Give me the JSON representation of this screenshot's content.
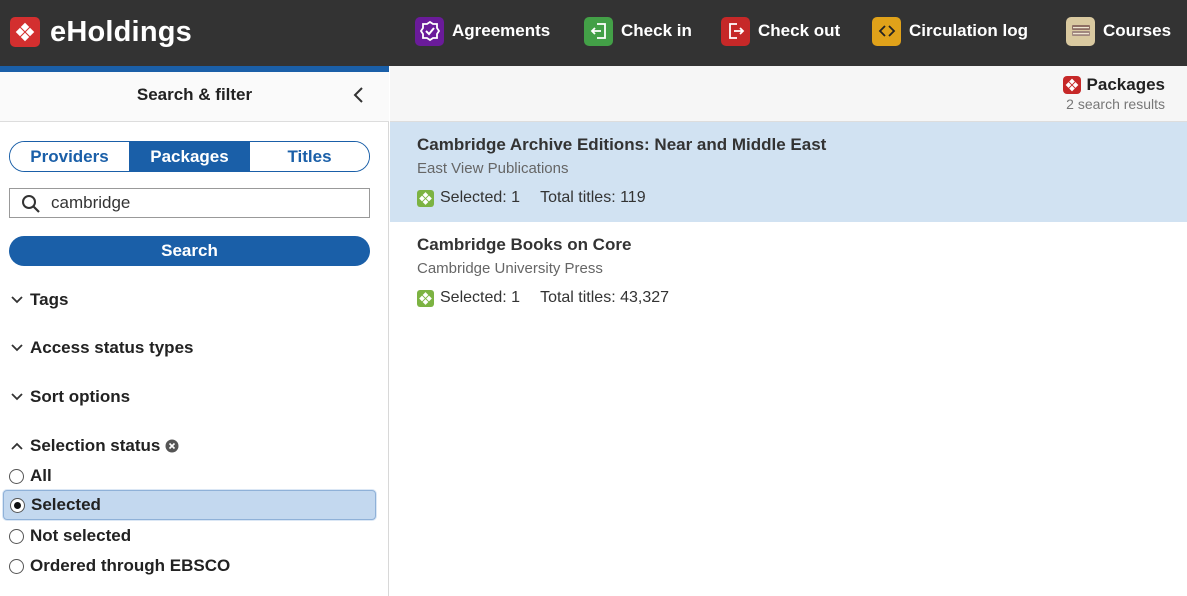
{
  "app": {
    "title": "eHoldings"
  },
  "nav": {
    "items": [
      {
        "label": "Agreements",
        "icon": "agreements-icon",
        "color": "#6a1b9a"
      },
      {
        "label": "Check in",
        "icon": "check-in-icon",
        "color": "#43a047"
      },
      {
        "label": "Check out",
        "icon": "check-out-icon",
        "color": "#c62828"
      },
      {
        "label": "Circulation log",
        "icon": "circulation-log-icon",
        "color": "#e0a21a"
      },
      {
        "label": "Courses",
        "icon": "courses-icon",
        "color": "#c8b68a"
      }
    ]
  },
  "filter": {
    "title": "Search & filter",
    "segments": [
      {
        "label": "Providers",
        "active": false
      },
      {
        "label": "Packages",
        "active": true
      },
      {
        "label": "Titles",
        "active": false
      }
    ],
    "search": {
      "value": "cambridge",
      "button_label": "Search"
    },
    "accordions": [
      {
        "label": "Tags",
        "expanded": false
      },
      {
        "label": "Access status types",
        "expanded": false
      },
      {
        "label": "Sort options",
        "expanded": false
      },
      {
        "label": "Selection status",
        "expanded": true
      }
    ],
    "selection_status": {
      "options": [
        {
          "label": "All",
          "checked": false
        },
        {
          "label": "Selected",
          "checked": true
        },
        {
          "label": "Not selected",
          "checked": false
        },
        {
          "label": "Ordered through EBSCO",
          "checked": false
        }
      ]
    }
  },
  "results": {
    "pane_title": "Packages",
    "subtitle": "2 search results",
    "items": [
      {
        "title": "Cambridge Archive Editions: Near and Middle East",
        "provider": "East View Publications",
        "selected": "Selected: 1",
        "total": "Total titles: 119",
        "active": true
      },
      {
        "title": "Cambridge Books on Core",
        "provider": "Cambridge University Press",
        "selected": "Selected: 1",
        "total": "Total titles: 43,327",
        "active": false
      }
    ]
  },
  "colors": {
    "primary": "#1a5fa8",
    "topbar": "#333333",
    "active_row": "#d1e2f2",
    "selected_radio_row": "#c3d8ef"
  }
}
